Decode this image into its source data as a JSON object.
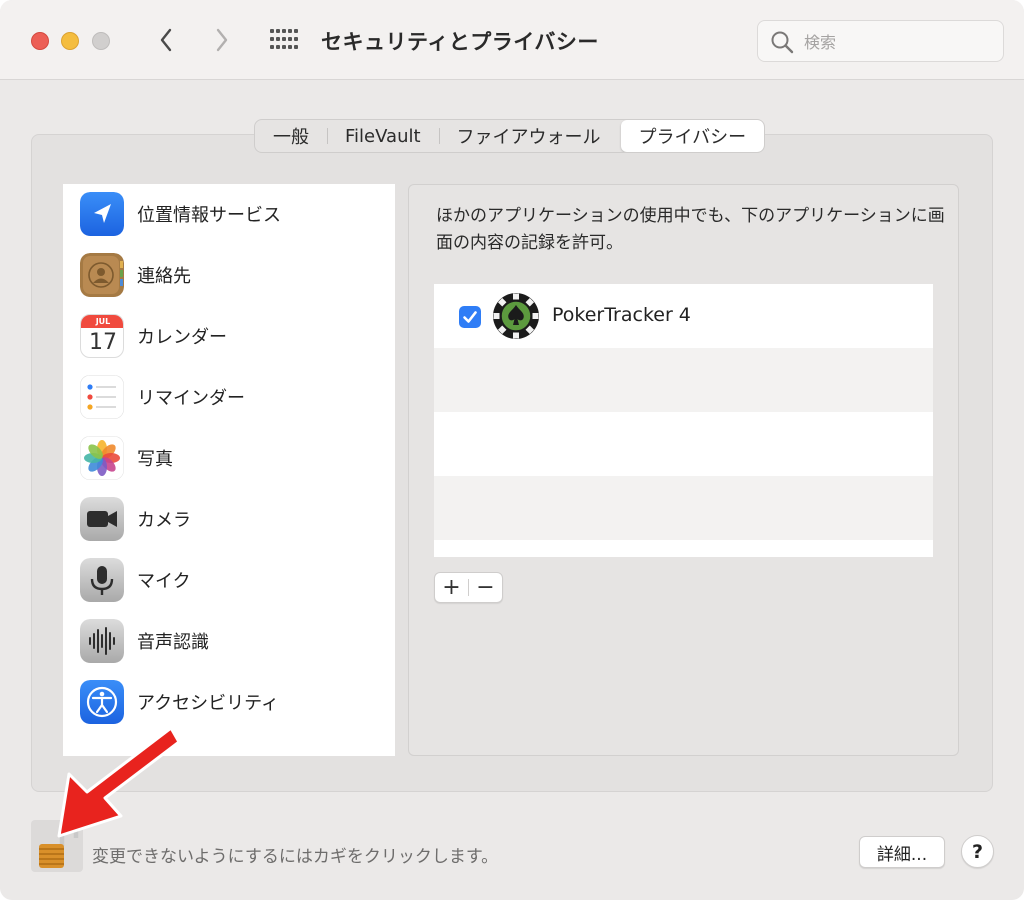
{
  "window": {
    "title": "セキュリティとプライバシー",
    "search_placeholder": "検索"
  },
  "tabs": [
    {
      "label": "一般",
      "active": false
    },
    {
      "label": "FileVault",
      "active": false
    },
    {
      "label": "ファイアウォール",
      "active": false
    },
    {
      "label": "プライバシー",
      "active": true
    }
  ],
  "sidebar": {
    "items": [
      {
        "label": "位置情報サービス",
        "icon": "location-arrow-icon"
      },
      {
        "label": "連絡先",
        "icon": "contacts-icon"
      },
      {
        "label": "カレンダー",
        "icon": "calendar-icon",
        "icon_month": "JUL",
        "icon_day": "17"
      },
      {
        "label": "リマインダー",
        "icon": "reminders-icon"
      },
      {
        "label": "写真",
        "icon": "photos-icon"
      },
      {
        "label": "カメラ",
        "icon": "camera-icon"
      },
      {
        "label": "マイク",
        "icon": "microphone-icon"
      },
      {
        "label": "音声認識",
        "icon": "speech-recognition-icon"
      },
      {
        "label": "アクセシビリティ",
        "icon": "accessibility-icon"
      }
    ]
  },
  "main": {
    "description": "ほかのアプリケーションの使用中でも、下のアプリケーションに画面の内容の記録を許可。",
    "apps": [
      {
        "name": "PokerTracker 4",
        "checked": true,
        "icon": "pokertracker-chip-icon"
      }
    ],
    "add_label": "+",
    "remove_label": "−"
  },
  "footer": {
    "lock_text": "変更できないようにするにはカギをクリックします。",
    "details_label": "詳細...",
    "help_label": "?"
  },
  "colors": {
    "accent": "#2f7df6",
    "annotation_arrow": "#e8231e"
  }
}
